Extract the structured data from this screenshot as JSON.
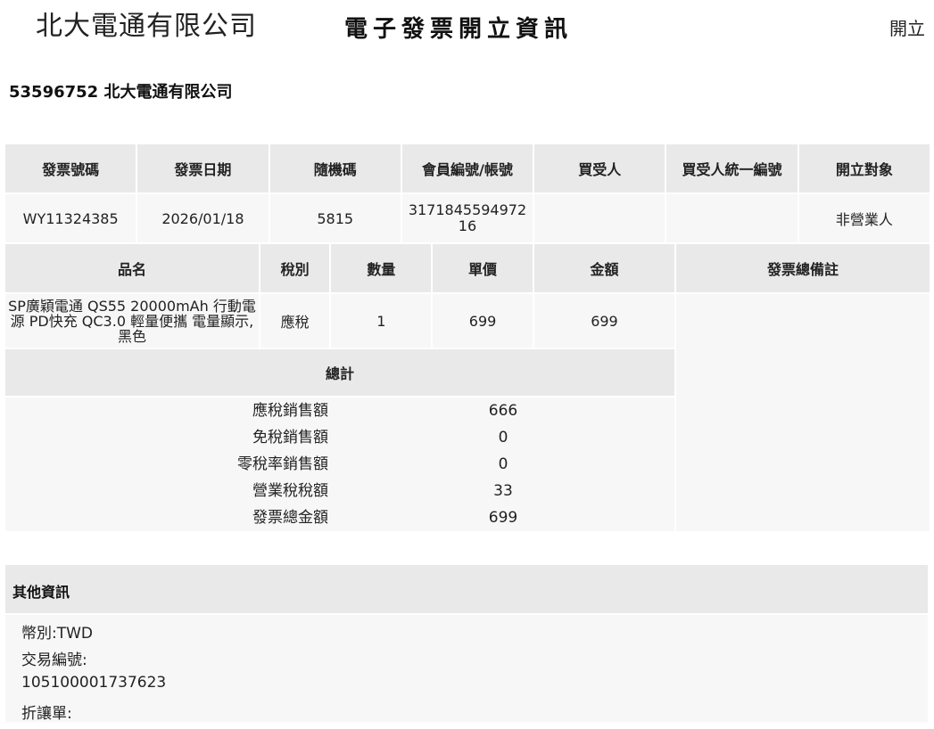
{
  "header": {
    "company": "北大電通有限公司",
    "title": "電子發票開立資訊",
    "right_label": "開立"
  },
  "seller": "53596752 北大電通有限公司",
  "invoice_table": {
    "headers": [
      "發票號碼",
      "發票日期",
      "隨機碼",
      "會員編號/帳號",
      "買受人",
      "買受人統一編號",
      "開立對象"
    ],
    "row": {
      "number": "WY11324385",
      "date": "2026/01/18",
      "random_code": "5815",
      "member_id": "317184559497216",
      "buyer": "",
      "buyer_tax_id": "",
      "issue_target": "非營業人"
    }
  },
  "items_table": {
    "headers": [
      "品名",
      "稅別",
      "數量",
      "單價",
      "金額"
    ],
    "remark_header": "發票總備註",
    "items": [
      {
        "name": "SP廣穎電通 QS55 20000mAh 行動電源 PD快充 QC3.0 輕量便攜 電量顯示, 黑色",
        "tax_type": "應稅",
        "quantity": "1",
        "unit_price": "699",
        "amount": "699"
      }
    ]
  },
  "totals": {
    "header": "總計",
    "lines": [
      {
        "label": "應稅銷售額",
        "value": "666"
      },
      {
        "label": "免稅銷售額",
        "value": "0"
      },
      {
        "label": "零稅率銷售額",
        "value": "0"
      },
      {
        "label": "營業稅稅額",
        "value": "33"
      },
      {
        "label": "發票總金額",
        "value": "699"
      }
    ]
  },
  "other_info": {
    "header": "其他資訊",
    "lines": [
      "幣別:TWD",
      "交易編號:",
      "105100001737623",
      "折讓單:"
    ]
  }
}
